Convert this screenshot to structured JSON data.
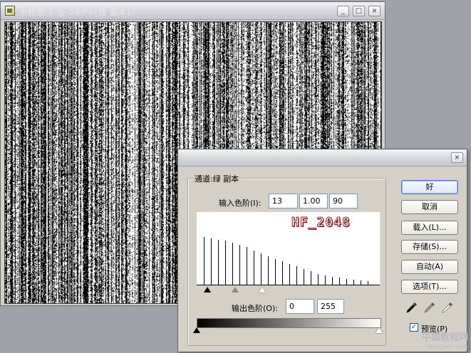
{
  "document": {
    "title": "未标题-1 @ 100%(绿 副本)",
    "minimize_glyph": "_",
    "maximize_glyph": "□",
    "close_glyph": "×"
  },
  "dialog": {
    "close_glyph": "×",
    "channel_label": "通道:绿 副本",
    "input_levels": {
      "label": "输入色阶(I):",
      "black": "13",
      "gamma": "1.00",
      "white": "90"
    },
    "output_levels": {
      "label": "输出色阶(O):",
      "black": "0",
      "white": "255"
    },
    "histogram_watermark": "HF_2048",
    "buttons": {
      "ok": "好",
      "cancel": "取消",
      "load": "载入(L)...",
      "save": "存储(S)...",
      "auto": "自动(A)",
      "options": "选项(T)..."
    },
    "preview": {
      "label": "预览(P)",
      "checked": true,
      "check_glyph": "✓"
    }
  },
  "histogram": [
    0.66,
    0.64,
    0.62,
    0.61,
    0.58,
    0.55,
    0.52,
    0.48,
    0.44,
    0.4,
    0.36,
    0.33,
    0.29,
    0.26,
    0.22,
    0.19,
    0.16,
    0.14,
    0.12,
    0.11,
    0.09,
    0.08,
    0.07,
    0.06
  ],
  "site_watermark": {
    "name": "中国教程网",
    "url": "bbs.jcwcn.com"
  },
  "colors": {
    "accent": "#5173c7",
    "titlebar": "#d9dbe0"
  }
}
